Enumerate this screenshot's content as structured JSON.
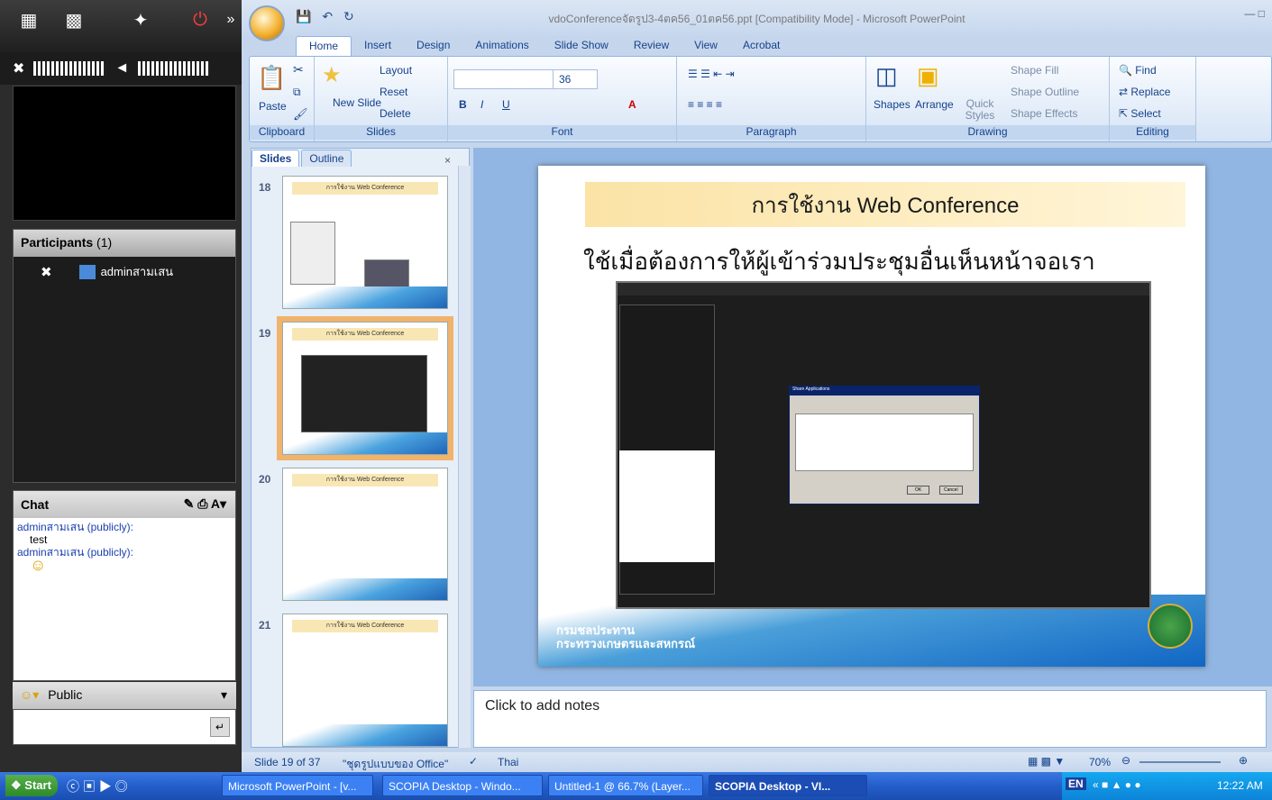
{
  "scopia": {
    "participants_label": "Participants",
    "participants_count": "(1)",
    "participant_name": "adminสามเสน",
    "chat_label": "Chat",
    "chat_messages": [
      {
        "sender": "adminสามเสน (publicly):",
        "text": "test"
      },
      {
        "sender": "adminสามเสน (publicly):",
        "text": ""
      }
    ],
    "public_label": "Public"
  },
  "ppt": {
    "window_title": "vdoConferenceจัดรูป3-4ตค56_01ตค56.ppt [Compatibility Mode] - Microsoft PowerPoint",
    "tabs": [
      "Home",
      "Insert",
      "Design",
      "Animations",
      "Slide Show",
      "Review",
      "View",
      "Acrobat"
    ],
    "ribbon": {
      "paste": "Paste",
      "new_slide": "New Slide",
      "layout": "Layout",
      "reset": "Reset",
      "delete": "Delete",
      "font_size": "36",
      "shapes": "Shapes",
      "arrange": "Arrange",
      "quick_styles": "Quick Styles",
      "shape_fill": "Shape Fill",
      "shape_outline": "Shape Outline",
      "shape_effects": "Shape Effects",
      "find": "Find",
      "replace": "Replace",
      "select": "Select",
      "groups": [
        "Clipboard",
        "Slides",
        "Font",
        "Paragraph",
        "Drawing",
        "Editing"
      ]
    },
    "pane_tabs": [
      "Slides",
      "Outline"
    ],
    "thumbnails": [
      {
        "num": "18",
        "title": "การใช้งาน Web Conference"
      },
      {
        "num": "19",
        "title": "การใช้งาน Web Conference"
      },
      {
        "num": "20",
        "title": "การใช้งาน Web Conference"
      },
      {
        "num": "21",
        "title": "การใช้งาน Web Conference"
      }
    ],
    "slide": {
      "title": "การใช้งาน Web Conference",
      "subtitle": "ใช้เมื่อต้องการให้ผู้เข้าร่วมประชุมอื่นเห็นหน้าจอเรา",
      "footer_line1": "กรมชลประทาน",
      "footer_line2": "กระทรวงเกษตรและสหกรณ์",
      "dialog_title": "Share Applications",
      "dialog_ok": "OK",
      "dialog_cancel": "Cancel"
    },
    "notes_placeholder": "Click to add notes",
    "status": {
      "slide": "Slide 19 of 37",
      "theme": "\"ชุดรูปแบบของ Office\"",
      "language": "Thai",
      "zoom": "70%"
    }
  },
  "taskbar": {
    "start": "Start",
    "items": [
      "Microsoft PowerPoint - [v...",
      "SCOPIA Desktop - Windo...",
      "Untitled-1 @ 66.7% (Layer...",
      "SCOPIA Desktop - VI..."
    ],
    "lang": "EN",
    "clock": "12:22 AM"
  }
}
